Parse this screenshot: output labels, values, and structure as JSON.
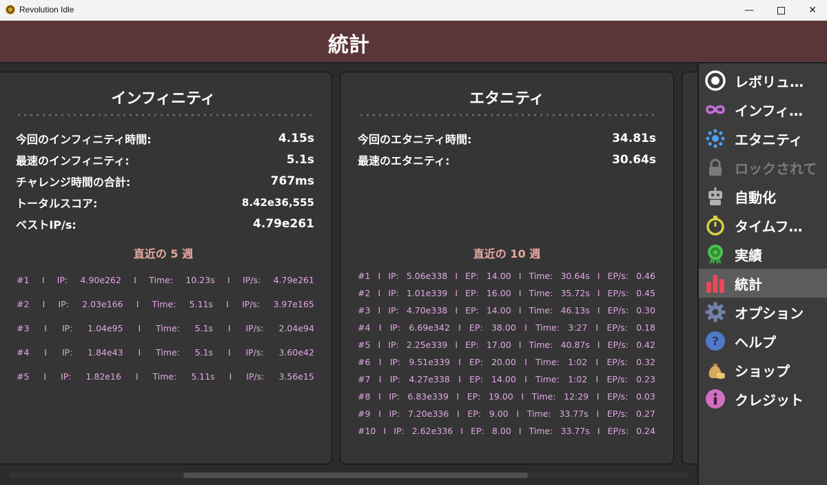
{
  "window": {
    "title": "Revolution Idle",
    "minimize": "—",
    "close": "✕"
  },
  "header": {
    "title": "統計"
  },
  "infinity": {
    "title": "インフィニティ",
    "stats": [
      {
        "label": "今回のインフィニティ時間:",
        "value": "4.15s"
      },
      {
        "label": "最速のインフィニティ:",
        "value": "5.1s"
      },
      {
        "label": "チャレンジ時間の合計:",
        "value": "767ms"
      },
      {
        "label": "トータルスコア:",
        "value": "8.42e36,555"
      },
      {
        "label": "ベストIP/s:",
        "value": "4.79e261"
      }
    ],
    "recent_heading": "直近の 5 週",
    "runs": [
      [
        "#1",
        "I",
        "IP:",
        "4.90e262",
        "I",
        "Time:",
        "10.23s",
        "I",
        "IP/s:",
        "4.79e261"
      ],
      [
        "#2",
        "I",
        "IP:",
        "2.03e166",
        "I",
        "Time:",
        "5.11s",
        "I",
        "IP/s:",
        "3.97e165"
      ],
      [
        "#3",
        "I",
        "IP:",
        "1.04e95",
        "I",
        "Time:",
        "5.1s",
        "I",
        "IP/s:",
        "2.04e94"
      ],
      [
        "#4",
        "I",
        "IP:",
        "1.84e43",
        "I",
        "Time:",
        "5.1s",
        "I",
        "IP/s:",
        "3.60e42"
      ],
      [
        "#5",
        "I",
        "IP:",
        "1.82e16",
        "I",
        "Time:",
        "5.11s",
        "I",
        "IP/s:",
        "3.56e15"
      ]
    ]
  },
  "eternity": {
    "title": "エタニティ",
    "stats": [
      {
        "label": "今回のエタニティ時間:",
        "value": "34.81s"
      },
      {
        "label": "最速のエタニティ:",
        "value": "30.64s"
      }
    ],
    "recent_heading": "直近の 10 週",
    "runs": [
      [
        "#1",
        "I",
        "IP:",
        "5.06e338",
        "I",
        "EP:",
        "14.00",
        "I",
        "Time:",
        "30.64s",
        "I",
        "EP/s:",
        "0.46"
      ],
      [
        "#2",
        "I",
        "IP:",
        "1.01e339",
        "I",
        "EP:",
        "16.00",
        "I",
        "Time:",
        "35.72s",
        "I",
        "EP/s:",
        "0.45"
      ],
      [
        "#3",
        "I",
        "IP:",
        "4.70e338",
        "I",
        "EP:",
        "14.00",
        "I",
        "Time:",
        "46.13s",
        "I",
        "EP/s:",
        "0.30"
      ],
      [
        "#4",
        "I",
        "IP:",
        "6.69e342",
        "I",
        "EP:",
        "38.00",
        "I",
        "Time:",
        "3:27",
        "I",
        "EP/s:",
        "0.18"
      ],
      [
        "#5",
        "I",
        "IP:",
        "2.25e339",
        "I",
        "EP:",
        "17.00",
        "I",
        "Time:",
        "40.87s",
        "I",
        "EP/s:",
        "0.42"
      ],
      [
        "#6",
        "I",
        "IP:",
        "9.51e339",
        "I",
        "EP:",
        "20.00",
        "I",
        "Time:",
        "1:02",
        "I",
        "EP/s:",
        "0.32"
      ],
      [
        "#7",
        "I",
        "IP:",
        "4.27e338",
        "I",
        "EP:",
        "14.00",
        "I",
        "Time:",
        "1:02",
        "I",
        "EP/s:",
        "0.23"
      ],
      [
        "#8",
        "I",
        "IP:",
        "6.83e339",
        "I",
        "EP:",
        "19.00",
        "I",
        "Time:",
        "12:29",
        "I",
        "EP/s:",
        "0.03"
      ],
      [
        "#9",
        "I",
        "IP:",
        "7.20e336",
        "I",
        "EP:",
        "9.00",
        "I",
        "Time:",
        "33.77s",
        "I",
        "EP/s:",
        "0.27"
      ],
      [
        "#10",
        "I",
        "IP:",
        "2.62e336",
        "I",
        "EP:",
        "8.00",
        "I",
        "Time:",
        "33.77s",
        "I",
        "EP/s:",
        "0.24"
      ]
    ]
  },
  "sidebar": {
    "items": [
      {
        "label": "レボリュ…",
        "icon": "target-icon",
        "color": "#ffffff",
        "active": false,
        "locked": false
      },
      {
        "label": "インフィ…",
        "icon": "infinity-icon",
        "color": "#c86ee0",
        "active": false,
        "locked": false
      },
      {
        "label": "エタニティ",
        "icon": "dot-ring-icon",
        "color": "#4aa0f0",
        "active": false,
        "locked": false
      },
      {
        "label": "ロックされて",
        "icon": "lock-icon",
        "color": "#7a7a7a",
        "active": false,
        "locked": true
      },
      {
        "label": "自動化",
        "icon": "robot-icon",
        "color": "#b0b0b0",
        "active": false,
        "locked": false
      },
      {
        "label": "タイムフ…",
        "icon": "stopwatch-icon",
        "color": "#d8d040",
        "active": false,
        "locked": false
      },
      {
        "label": "実績",
        "icon": "award-icon",
        "color": "#4ec050",
        "active": false,
        "locked": false
      },
      {
        "label": "統計",
        "icon": "bar-chart-icon",
        "color": "#e84a5a",
        "active": true,
        "locked": false
      },
      {
        "label": "オプション",
        "icon": "gear-icon",
        "color": "#7080a8",
        "active": false,
        "locked": false
      },
      {
        "label": "ヘルプ",
        "icon": "help-icon",
        "color": "#5078c8",
        "active": false,
        "locked": false
      },
      {
        "label": "ショップ",
        "icon": "money-bag-icon",
        "color": "#d8a860",
        "active": false,
        "locked": false
      },
      {
        "label": "クレジット",
        "icon": "info-icon",
        "color": "#d070c0",
        "active": false,
        "locked": false
      }
    ]
  }
}
